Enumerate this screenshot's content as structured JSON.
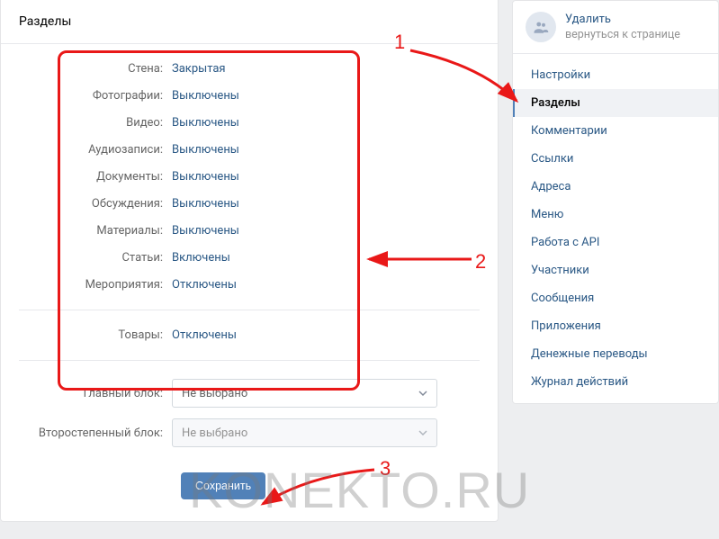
{
  "header": {
    "title": "Разделы"
  },
  "settings": [
    {
      "label": "Стена:",
      "value": "Закрытая"
    },
    {
      "label": "Фотографии:",
      "value": "Выключены"
    },
    {
      "label": "Видео:",
      "value": "Выключены"
    },
    {
      "label": "Аудиозаписи:",
      "value": "Выключены"
    },
    {
      "label": "Документы:",
      "value": "Выключены"
    },
    {
      "label": "Обсуждения:",
      "value": "Выключены"
    },
    {
      "label": "Материалы:",
      "value": "Выключены"
    },
    {
      "label": "Статьи:",
      "value": "Включены"
    },
    {
      "label": "Мероприятия:",
      "value": "Отключены"
    }
  ],
  "goods": {
    "label": "Товары:",
    "value": "Отключены"
  },
  "blocks": {
    "main_label": "Главный блок:",
    "main_value": "Не выбрано",
    "secondary_label": "Второстепенный блок:",
    "secondary_value": "Не выбрано"
  },
  "save_label": "Сохранить",
  "sidebar": {
    "delete": "Удалить",
    "return": "вернуться к странице",
    "nav": [
      "Настройки",
      "Разделы",
      "Комментарии",
      "Ссылки",
      "Адреса",
      "Меню",
      "Работа с API",
      "Участники",
      "Сообщения",
      "Приложения",
      "Денежные переводы",
      "Журнал действий"
    ],
    "active_index": 1
  },
  "annotations": {
    "n1": "1",
    "n2": "2",
    "n3": "3"
  },
  "watermark": "KONEKTO.RU"
}
